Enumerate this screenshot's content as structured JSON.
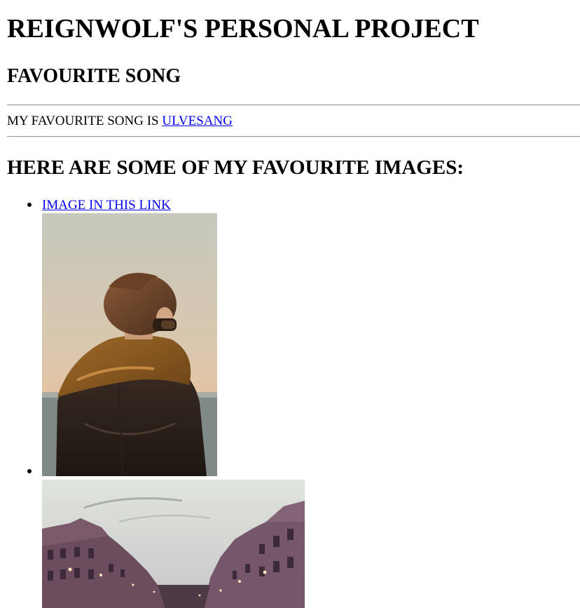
{
  "page": {
    "title": "REIGNWOLF'S PERSONAL PROJECT",
    "subtitle": "FAVOURITE SONG",
    "song_prefix": "MY FAVOURITE SONG IS ",
    "song_link": "ULVESANG",
    "images_heading": "HERE ARE SOME OF MY FAVOURITE IMAGES:"
  },
  "images": [
    {
      "link_text": "IMAGE IN THIS LINK",
      "subject": "person-in-leather-jacket-photo"
    },
    {
      "subject": "city-street-photo"
    }
  ],
  "colors": {
    "link": "#0000ee",
    "text": "#000000",
    "rule": "#9a9a9a"
  }
}
